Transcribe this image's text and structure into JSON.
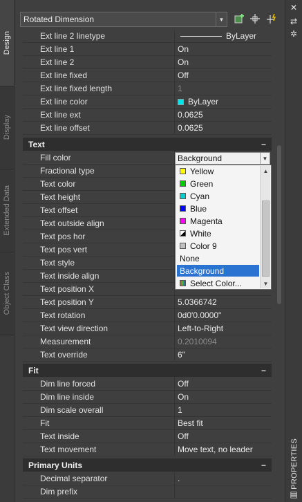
{
  "left_tabs": [
    {
      "label": "Design"
    },
    {
      "label": "Display"
    },
    {
      "label": "Extended Data"
    },
    {
      "label": "Object Class"
    }
  ],
  "toolbar": {
    "object_type": "Rotated Dimension",
    "icons": [
      "add-to-selection-icon",
      "select-objects-icon",
      "quick-select-icon"
    ]
  },
  "rows_top": [
    {
      "label": "Ext line 2 linetype",
      "value": "ByLayer",
      "line": true
    },
    {
      "label": "Ext line 1",
      "value": "On"
    },
    {
      "label": "Ext line 2",
      "value": "On"
    },
    {
      "label": "Ext line fixed",
      "value": "Off"
    },
    {
      "label": "Ext line fixed length",
      "value": "1",
      "dim": true
    },
    {
      "label": "Ext line color",
      "value": "ByLayer",
      "swatch": "#00e5e5"
    },
    {
      "label": "Ext line ext",
      "value": "0.0625"
    },
    {
      "label": "Ext line offset",
      "value": "0.0625"
    }
  ],
  "sections": {
    "text": "Text",
    "fit": "Fit",
    "primary_units": "Primary Units"
  },
  "text_rows": [
    {
      "label": "Fill color",
      "value": "Background"
    },
    {
      "label": "Fractional type",
      "value": ""
    },
    {
      "label": "Text color",
      "value": ""
    },
    {
      "label": "Text height",
      "value": ""
    },
    {
      "label": "Text offset",
      "value": ""
    },
    {
      "label": "Text outside align",
      "value": ""
    },
    {
      "label": "Text pos hor",
      "value": ""
    },
    {
      "label": "Text pos vert",
      "value": ""
    },
    {
      "label": "Text style",
      "value": ""
    },
    {
      "label": "Text inside align",
      "value": ""
    },
    {
      "label": "Text position X",
      "value": ""
    },
    {
      "label": "Text position Y",
      "value": "5.0366742"
    },
    {
      "label": "Text rotation",
      "value": "0d0'0.0000\""
    },
    {
      "label": "Text view direction",
      "value": "Left-to-Right"
    },
    {
      "label": "Measurement",
      "value": "0.2010094",
      "dim": true
    },
    {
      "label": "Text override",
      "value": "6\""
    }
  ],
  "fill_dropdown": {
    "current": "Background",
    "options": [
      {
        "label": "Yellow",
        "color": "#ffff00"
      },
      {
        "label": "Green",
        "color": "#00cc00"
      },
      {
        "label": "Cyan",
        "color": "#00d0d0"
      },
      {
        "label": "Blue",
        "color": "#0000ff"
      },
      {
        "label": "Magenta",
        "color": "#ff00ff"
      },
      {
        "label": "White",
        "color": "split"
      },
      {
        "label": "Color 9",
        "color": "#c0c0c0"
      },
      {
        "label": "None",
        "color": ""
      },
      {
        "label": "Background",
        "color": "",
        "selected": true
      },
      {
        "label": "Select Color...",
        "color": "select"
      }
    ]
  },
  "fit_rows": [
    {
      "label": "Dim line forced",
      "value": "Off"
    },
    {
      "label": "Dim line inside",
      "value": "On"
    },
    {
      "label": "Dim scale overall",
      "value": "1"
    },
    {
      "label": "Fit",
      "value": "Best fit"
    },
    {
      "label": "Text inside",
      "value": "Off"
    },
    {
      "label": "Text movement",
      "value": "Move text, no leader"
    }
  ],
  "units_rows": [
    {
      "label": "Decimal separator",
      "value": "."
    },
    {
      "label": "Dim prefix",
      "value": ""
    }
  ],
  "right_strip": {
    "label": "PROPERTIES",
    "icons": [
      "close-icon",
      "auto-hide-icon",
      "settings-icon"
    ]
  },
  "colors": {
    "panel_bg": "#3f3f3f",
    "section_bg": "#2e2e2e",
    "selected_bg": "#2a73d0"
  }
}
